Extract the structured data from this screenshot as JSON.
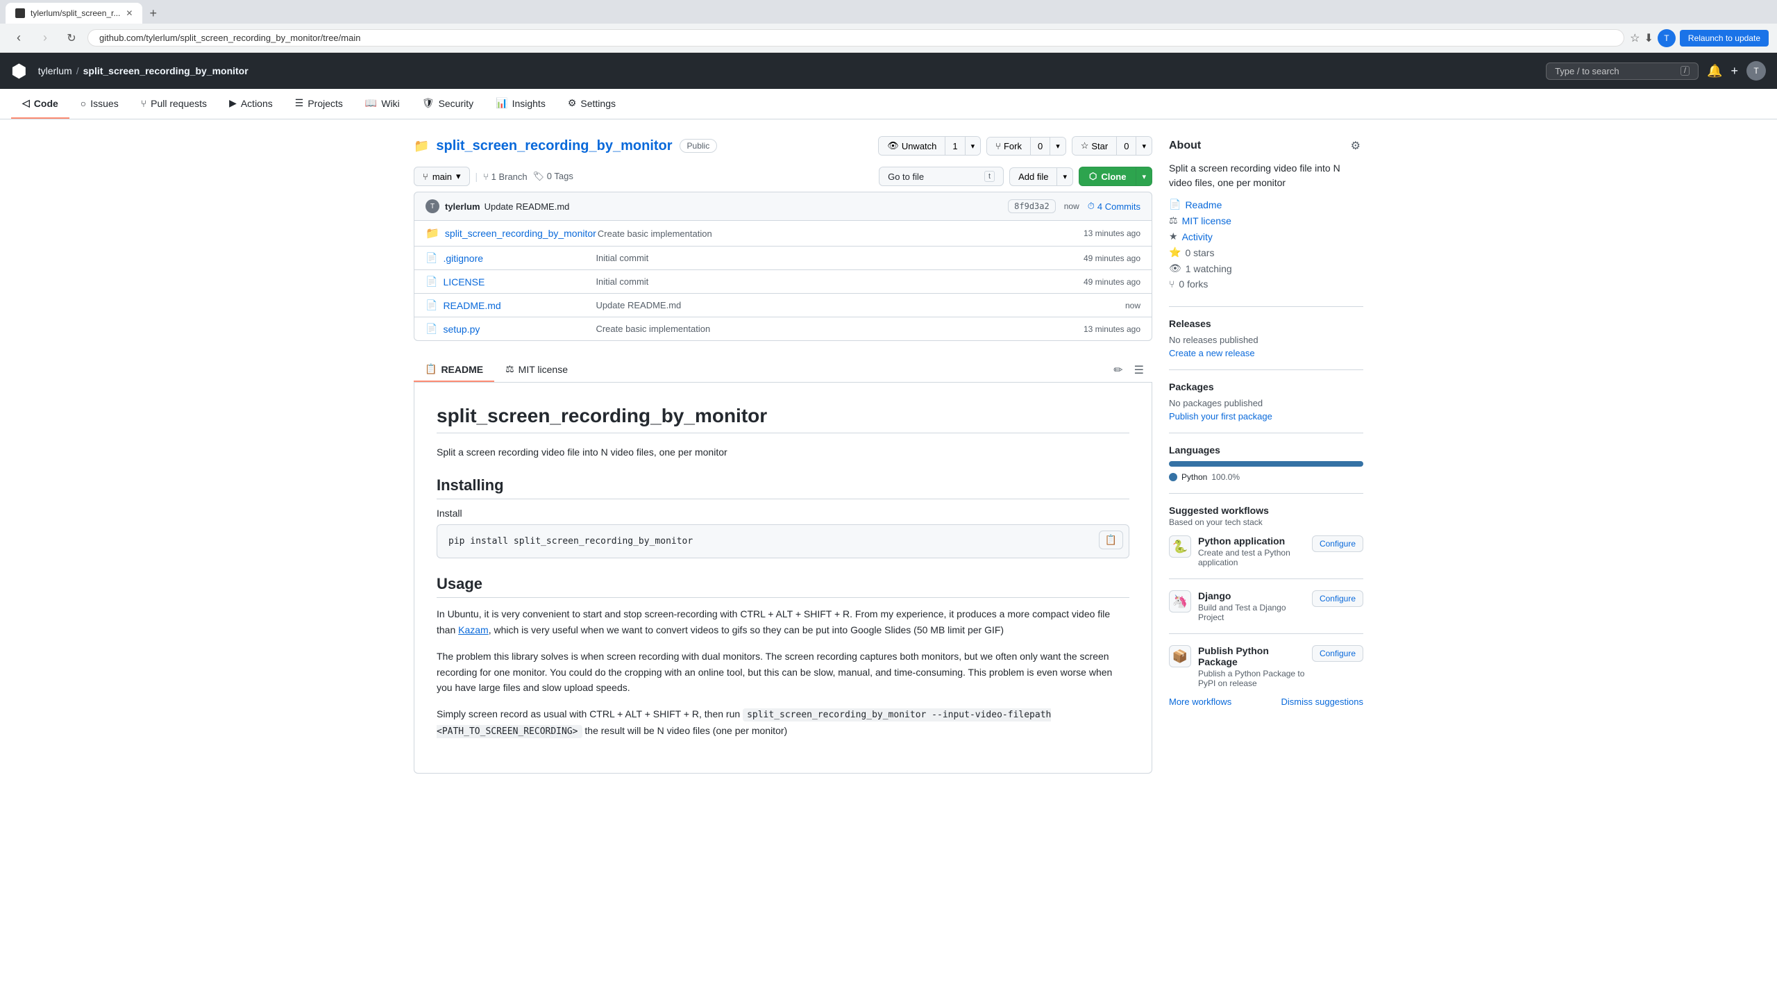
{
  "browser": {
    "tab_title": "tylerlum/split_screen_r...",
    "url": "github.com/tylerlum/split_screen_recording_by_monitor/tree/main",
    "relaunch_label": "Relaunch to update"
  },
  "github": {
    "logo": "⬛",
    "user": "tylerlum",
    "repo": "split_screen_recording_by_monitor",
    "search_placeholder": "Type / to search",
    "nav_items": [
      {
        "id": "code",
        "label": "Code",
        "icon": "◁",
        "active": true
      },
      {
        "id": "issues",
        "label": "Issues",
        "icon": "○"
      },
      {
        "id": "pull-requests",
        "label": "Pull requests",
        "icon": "⑂"
      },
      {
        "id": "actions",
        "label": "Actions",
        "icon": "▶"
      },
      {
        "id": "projects",
        "label": "Projects",
        "icon": "☰"
      },
      {
        "id": "wiki",
        "label": "Wiki",
        "icon": "📖"
      },
      {
        "id": "security",
        "label": "Security",
        "icon": "🛡"
      },
      {
        "id": "insights",
        "label": "Insights",
        "icon": "📊"
      },
      {
        "id": "settings",
        "label": "Settings",
        "icon": "⚙"
      }
    ]
  },
  "repo": {
    "name": "split_screen_recording_by_monitor",
    "visibility": "Public",
    "description": "Split a screen recording video file into N video files, one per monitor",
    "watch_label": "Unwatch",
    "watch_count": "1",
    "fork_label": "Fork",
    "fork_count": "0",
    "star_label": "Star",
    "star_count": "0"
  },
  "file_browser": {
    "branch": "main",
    "branch_count": "1 Branch",
    "tag_count": "0 Tags",
    "goto_file_label": "Go to file",
    "add_file_label": "Add file",
    "clone_label": "⬡ Clone",
    "commit": {
      "author": "tylerlum",
      "message": "Update README.md",
      "hash": "8f9d3a2",
      "time": "now",
      "commits_label": "4 Commits"
    },
    "files": [
      {
        "type": "folder",
        "name": "split_screen_recording_by_monitor",
        "desc": "Create basic implementation",
        "time": "13 minutes ago"
      },
      {
        "type": "file",
        "name": ".gitignore",
        "desc": "Initial commit",
        "time": "49 minutes ago"
      },
      {
        "type": "file",
        "name": "LICENSE",
        "desc": "Initial commit",
        "time": "49 minutes ago"
      },
      {
        "type": "file",
        "name": "README.md",
        "desc": "Update README.md",
        "time": "now"
      },
      {
        "type": "file",
        "name": "setup.py",
        "desc": "Create basic implementation",
        "time": "13 minutes ago"
      }
    ]
  },
  "readme": {
    "tabs": [
      {
        "label": "README",
        "active": true
      },
      {
        "label": "MIT license",
        "active": false
      }
    ],
    "title": "split_screen_recording_by_monitor",
    "subtitle": "Split a screen recording video file into N video files, one per monitor",
    "sections": [
      {
        "heading": "Installing",
        "content_before": "Install",
        "code": "pip install split_screen_recording_by_monitor",
        "content_after": ""
      }
    ],
    "usage_heading": "Usage",
    "usage_para1": "In Ubuntu, it is very convenient to start and stop screen-recording with CTRL + ALT + SHIFT + R. From my experience, it produces a more compact video file than Kazam, which is very useful when we want to convert videos to gifs so they can be put into Google Slides (50 MB limit per GIF)",
    "usage_kazam_link": "Kazam",
    "usage_para2": "The problem this library solves is when screen recording with dual monitors. The screen recording captures both monitors, but we often only want the screen recording for one monitor. You could do the cropping with an online tool, but this can be slow, manual, and time-consuming. This problem is even worse when you have large files and slow upload speeds.",
    "usage_para3": "Simply screen record as usual with CTRL + ALT + SHIFT + R, then run",
    "usage_inline_code": "split_screen_recording_by_monitor --input-video-filepath <PATH_TO_SCREEN_RECORDING>",
    "usage_para3_end": "the result will be N video files (one per monitor)"
  },
  "about": {
    "title": "About",
    "description": "Split a screen recording video file into N video files, one per monitor",
    "links": [
      {
        "icon": "📄",
        "label": "Readme"
      },
      {
        "icon": "⚖",
        "label": "MIT license"
      },
      {
        "icon": "★",
        "label": "Activity"
      },
      {
        "icon": "⭐",
        "label": "0 stars"
      },
      {
        "icon": "👁",
        "label": "1 watching"
      },
      {
        "icon": "⑂",
        "label": "0 forks"
      }
    ]
  },
  "releases": {
    "title": "Releases",
    "text": "No releases published",
    "link": "Create a new release"
  },
  "packages": {
    "title": "Packages",
    "text": "No packages published",
    "link": "Publish your first package"
  },
  "languages": {
    "title": "Languages",
    "items": [
      {
        "name": "Python",
        "percent": "100.0%",
        "color": "#3572A5",
        "width": 100
      }
    ]
  },
  "workflows": {
    "title": "Suggested workflows",
    "subtitle": "Based on your tech stack",
    "items": [
      {
        "icon": "🐍",
        "icon_bg": "#f6f8fa",
        "name": "Python application",
        "desc": "Create and test a Python application",
        "configure": "Configure"
      },
      {
        "icon": "🦄",
        "icon_bg": "#f6f8fa",
        "name": "Django",
        "desc": "Build and Test a Django Project",
        "configure": "Configure"
      },
      {
        "icon": "📦",
        "icon_bg": "#f6f8fa",
        "name": "Publish Python Package",
        "desc": "Publish a Python Package to PyPI on release",
        "configure": "Configure"
      }
    ],
    "more_link": "More workflows",
    "dismiss_link": "Dismiss suggestions"
  }
}
